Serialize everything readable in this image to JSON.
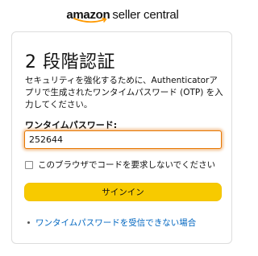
{
  "logo": {
    "brand": "amazon",
    "product": "seller central"
  },
  "card": {
    "title": "2 段階認証",
    "description": "セキュリティを強化するために、Authenticatorアプリで生成されたワンタイムパスワード (OTP) を入力してください。",
    "otp_label": "ワンタイムパスワード:",
    "otp_value": "252644",
    "remember_label": "このブラウザでコードを要求しないでください",
    "remember_checked": false,
    "signin_label": "サインイン",
    "help_link": "ワンタイムパスワードを受信できない場合"
  },
  "colors": {
    "button": "#f7ca00",
    "link": "#0066c0",
    "focus": "#e77600"
  }
}
